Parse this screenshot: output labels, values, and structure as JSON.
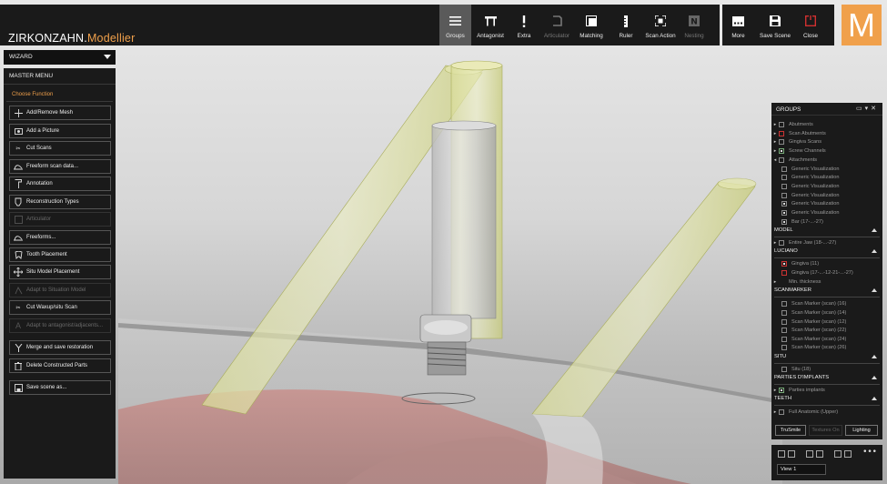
{
  "app": {
    "title_main": "ZIRKONZAHN.",
    "title_accent": "Modellier",
    "logo_letter": "M"
  },
  "toolbar": [
    {
      "label": "Groups",
      "icon": "menu-lines-icon",
      "active": true
    },
    {
      "label": "Antagonist",
      "icon": "antagonist-icon"
    },
    {
      "label": "Extra",
      "icon": "exclamation-icon"
    },
    {
      "label": "Articulator",
      "icon": "articulator-icon",
      "disabled": true
    },
    {
      "label": "Matching",
      "icon": "matching-icon"
    },
    {
      "label": "Ruler",
      "icon": "ruler-icon"
    },
    {
      "label": "Scan Action",
      "icon": "scan-action-icon"
    },
    {
      "label": "Nesting",
      "icon": "nesting-icon",
      "disabled": true
    }
  ],
  "toolbar_right": [
    {
      "label": "More",
      "icon": "more-icon"
    },
    {
      "label": "Save Scene",
      "icon": "save-icon"
    },
    {
      "label": "Close",
      "icon": "close-icon",
      "color": "#d03030"
    }
  ],
  "left": {
    "wizard": "WIZARD",
    "master_menu": "MASTER MENU",
    "choose_function": "Choose Function",
    "functions": [
      {
        "label": "Add/Remove Mesh",
        "icon": "plus-minus-icon"
      },
      {
        "label": "Add a Picture",
        "icon": "camera-icon"
      },
      {
        "label": "Cut Scans",
        "icon": "scissors-icon"
      },
      {
        "label": "Freeform scan data...",
        "icon": "freeform-icon"
      },
      {
        "label": "Annotation",
        "icon": "pin-icon"
      },
      {
        "label": "Reconstruction Types",
        "icon": "tooth-outline-icon"
      },
      {
        "label": "Articulator",
        "icon": "articulator-icon",
        "disabled": true
      },
      {
        "label": "Freeforms...",
        "icon": "freeform-icon"
      },
      {
        "label": "Tooth Placement",
        "icon": "tooth-icon"
      },
      {
        "label": "Situ Model Placement",
        "icon": "move-arrows-icon"
      },
      {
        "label": "Adapt to Situation Model",
        "icon": "adapt-icon",
        "disabled": true
      },
      {
        "label": "Cut Waxup/situ Scan",
        "icon": "scissors-icon"
      },
      {
        "label": "Adapt to antagonist/adjacents...",
        "icon": "adapt-text-icon",
        "disabled": true
      },
      {
        "label": "Merge and save restoration",
        "icon": "merge-icon"
      },
      {
        "label": "Delete Constructed Parts",
        "icon": "trash-icon"
      },
      {
        "label": "Save scene as...",
        "icon": "save-as-icon"
      }
    ]
  },
  "groups": {
    "title": "GROUPS",
    "items": [
      {
        "label": "Abutments",
        "indent": 0,
        "twisty": "▸",
        "cb": "off"
      },
      {
        "label": "Scan Abutments",
        "indent": 0,
        "twisty": "▸",
        "cb": "red"
      },
      {
        "label": "Gingiva Scans",
        "indent": 0,
        "twisty": "▸",
        "cb": "off"
      },
      {
        "label": "Screw Channels",
        "indent": 0,
        "twisty": "▸",
        "cb": "green-on"
      },
      {
        "label": "Attachments",
        "indent": 0,
        "twisty": "◂",
        "cb": "off"
      },
      {
        "label": "Generic Visualization",
        "indent": 1,
        "cb": "off"
      },
      {
        "label": "Generic Visualization",
        "indent": 1,
        "cb": "off"
      },
      {
        "label": "Generic Visualization",
        "indent": 1,
        "cb": "off"
      },
      {
        "label": "Generic Visualization",
        "indent": 1,
        "cb": "off"
      },
      {
        "label": "Generic Visualization",
        "indent": 1,
        "cb": "on"
      },
      {
        "label": "Generic Visualization",
        "indent": 1,
        "cb": "on"
      },
      {
        "label": "Bar (17-...-27)",
        "indent": 1,
        "cb": "on"
      }
    ],
    "model_title": "MODEL",
    "model_items": [
      {
        "label": "Entire Jaw (18-...-27)",
        "twisty": "▸",
        "cb": "off"
      }
    ],
    "luciano_title": "LUCIANO",
    "luciano_items": [
      {
        "label": "Gingiva (11)",
        "cb": "red-on"
      },
      {
        "label": "Gingiva (17-...-12-21-...-27)",
        "cb": "red"
      },
      {
        "label": "Min. thickness",
        "twisty": "▸",
        "cb": "none"
      }
    ],
    "scanmarker_title": "SCANMARKER",
    "scanmarker_items": [
      {
        "label": "Scan Marker (scan) (16)"
      },
      {
        "label": "Scan Marker (scan) (14)"
      },
      {
        "label": "Scan Marker (scan) (12)"
      },
      {
        "label": "Scan Marker (scan) (22)"
      },
      {
        "label": "Scan Marker (scan) (24)"
      },
      {
        "label": "Scan Marker (scan) (26)"
      }
    ],
    "situ_title": "SITU",
    "situ_items": [
      {
        "label": "Situ (18)"
      }
    ],
    "implants_title": "PARTIES D'IMPLANTS",
    "implants_items": [
      {
        "label": "Parties implants",
        "twisty": "▸",
        "cb": "green-on"
      }
    ],
    "teeth_title": "TEETH",
    "teeth_items": [
      {
        "label": "Full Anatomic (Upper)",
        "twisty": "▸",
        "cb": "off"
      }
    ],
    "buttons": {
      "trusmile": "TruSmile",
      "textures": "Textures On",
      "lighting": "Lighting"
    }
  },
  "view": {
    "more": "•••",
    "name": "View 1"
  },
  "colors": {
    "accent": "#f0a04b",
    "panel": "#1a1a1a",
    "gingiva": "#c87570",
    "channel": "#d5d88a"
  }
}
